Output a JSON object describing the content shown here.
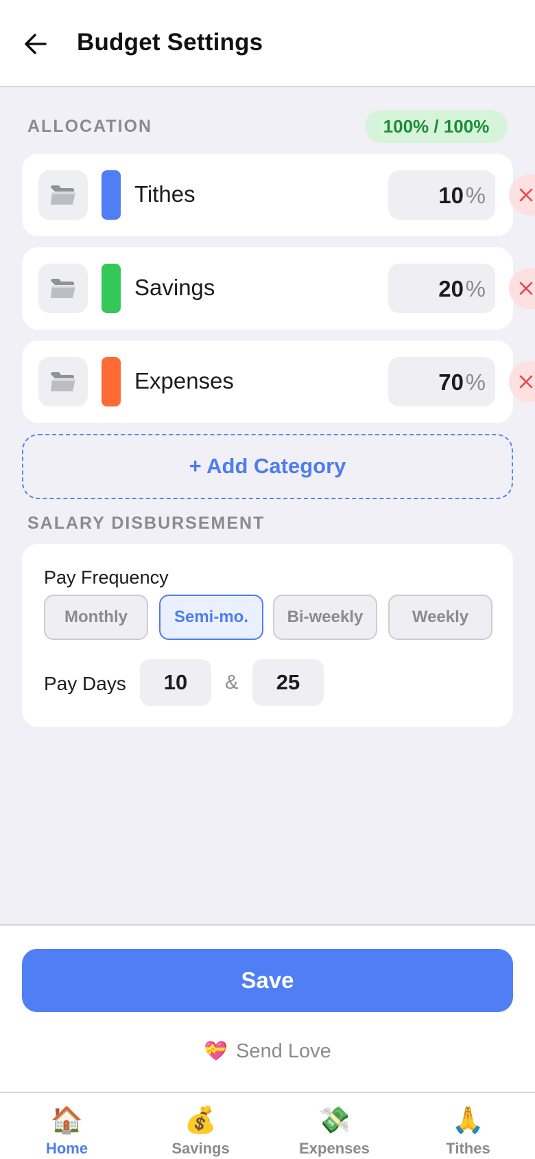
{
  "header": {
    "title": "Budget Settings"
  },
  "allocation": {
    "label": "ALLOCATION",
    "total": "100% / 100%",
    "categories": [
      {
        "name": "Tithes",
        "percent": "10",
        "unit": "%",
        "color": "#4f7ef5"
      },
      {
        "name": "Savings",
        "percent": "20",
        "unit": "%",
        "color": "#34c759"
      },
      {
        "name": "Expenses",
        "percent": "70",
        "unit": "%",
        "color": "#ff6b35"
      }
    ],
    "add_label": "+ Add Category"
  },
  "salary": {
    "label": "SALARY DISBURSEMENT",
    "pay_frequency_label": "Pay Frequency",
    "frequencies": [
      "Monthly",
      "Semi-mo.",
      "Bi-weekly",
      "Weekly"
    ],
    "selected_frequency": "Semi-mo.",
    "pay_days_label": "Pay Days",
    "pay_day_1": "10",
    "separator": "&",
    "pay_day_2": "25"
  },
  "footer": {
    "save_label": "Save",
    "send_love_label": "Send Love",
    "send_love_icon": "💝"
  },
  "tabs": [
    {
      "icon": "🏠",
      "label": "Home",
      "active": true
    },
    {
      "icon": "💰",
      "label": "Savings",
      "active": false
    },
    {
      "icon": "💸",
      "label": "Expenses",
      "active": false
    },
    {
      "icon": "🙏",
      "label": "Tithes",
      "active": false
    }
  ],
  "colors": {
    "accent": "#507ff5",
    "success": "#1c8c37",
    "danger": "#e5484d"
  }
}
